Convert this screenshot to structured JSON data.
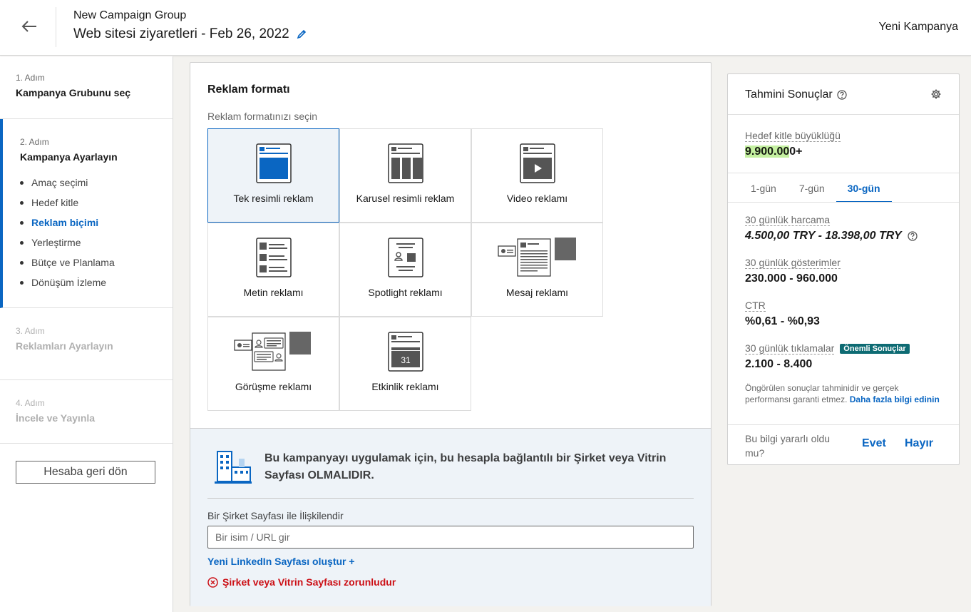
{
  "header": {
    "subtitle": "New Campaign Group",
    "title": "Web sitesi ziyaretleri - Feb 26, 2022",
    "right_label": "Yeni Kampanya"
  },
  "sidebar": {
    "steps": [
      {
        "num": "1. Adım",
        "title": "Kampanya Grubunu seç"
      },
      {
        "num": "2. Adım",
        "title": "Kampanya Ayarlayın",
        "items": [
          "Amaç seçimi",
          "Hedef kitle",
          "Reklam biçimi",
          "Yerleştirme",
          "Bütçe ve Planlama",
          "Dönüşüm İzleme"
        ]
      },
      {
        "num": "3. Adım",
        "title": "Reklamları Ayarlayın"
      },
      {
        "num": "4. Adım",
        "title": "İncele ve Yayınla"
      }
    ],
    "back_button": "Hesaba geri dön"
  },
  "ad_format": {
    "title": "Reklam formatı",
    "subtitle": "Reklam formatınızı seçin",
    "formats": [
      {
        "label": "Tek resimli reklam",
        "icon": "single-image-ad-icon",
        "selected": true
      },
      {
        "label": "Karusel resimli reklam",
        "icon": "carousel-ad-icon",
        "selected": false
      },
      {
        "label": "Video reklamı",
        "icon": "video-ad-icon",
        "selected": false
      },
      {
        "label": "Metin reklamı",
        "icon": "text-ad-icon",
        "selected": false
      },
      {
        "label": "Spotlight reklamı",
        "icon": "spotlight-ad-icon",
        "selected": false
      },
      {
        "label": "Mesaj reklamı",
        "icon": "message-ad-icon",
        "selected": false
      },
      {
        "label": "Görüşme reklamı",
        "icon": "conversation-ad-icon",
        "selected": false
      },
      {
        "label": "Etkinlik reklamı",
        "icon": "event-ad-icon",
        "selected": false,
        "calendar_day": "31"
      }
    ]
  },
  "company_page": {
    "warning": "Bu kampanyayı uygulamak için, bu hesapla bağlantılı bir Şirket veya Vitrin Sayfası OLMALIDIR.",
    "assoc_label": "Bir Şirket Sayfası ile İlişkilendir",
    "input_placeholder": "Bir isim / URL gir",
    "input_value": "",
    "new_page_link": "Yeni LinkedIn Sayfası oluştur +",
    "error": "Şirket veya Vitrin Sayfası zorunludur"
  },
  "estimates": {
    "title": "Tahmini Sonuçlar",
    "audience_label": "Hedef kitle büyüklüğü",
    "audience_value_highlight": "9.900.00",
    "audience_value_rest": "0+",
    "tabs": [
      "1-gün",
      "7-gün",
      "30-gün"
    ],
    "active_tab": "30-gün",
    "metrics": [
      {
        "label": "30 günlük harcama",
        "value": "4.500,00 TRY - 18.398,00 TRY"
      },
      {
        "label": "30 günlük gösterimler",
        "value": "230.000 - 960.000"
      },
      {
        "label": "CTR",
        "value": "%0,61 - %0,93"
      },
      {
        "label": "30 günlük tıklamalar",
        "value": "2.100 - 8.400",
        "badge": "Önemli Sonuçlar"
      }
    ],
    "disclaimer": "Öngörülen sonuçlar tahminidir ve gerçek performansı garanti etmez.",
    "disclaimer_link": "Daha fazla bilgi edinin",
    "feedback_question": "Bu bilgi yararlı oldu mu?",
    "yes": "Evet",
    "no": "Hayır"
  },
  "colors": {
    "accent": "#0a66c2",
    "error": "#cc1016",
    "badge": "#0e6b73",
    "highlight": "#c4f0a0"
  }
}
